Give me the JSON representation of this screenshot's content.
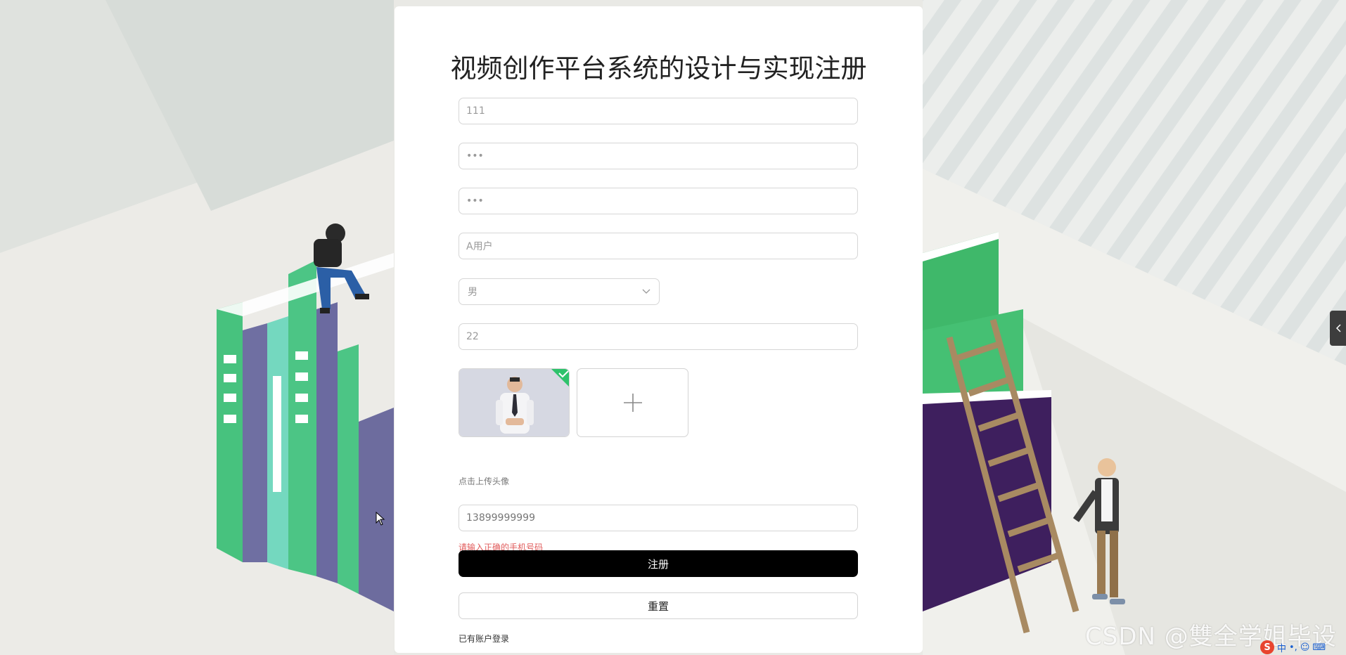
{
  "page": {
    "title": "视频创作平台系统的设计与实现注册"
  },
  "form": {
    "account": {
      "value": "111",
      "placeholder": ""
    },
    "password": {
      "value": "•••",
      "placeholder": ""
    },
    "confirm_password": {
      "value": "•••",
      "placeholder": ""
    },
    "name": {
      "value": "A用户",
      "placeholder": ""
    },
    "gender": {
      "selected": "男"
    },
    "age": {
      "value": "22",
      "placeholder": ""
    },
    "avatar_hint": "点击上传头像",
    "phone": {
      "value": "13899999999",
      "placeholder": ""
    },
    "phone_error": "请输入正确的手机号码",
    "register_label": "注册",
    "reset_label": "重置",
    "login_link": "已有账户登录"
  },
  "overlay": {
    "watermark": "CSDN @雙全学姐毕设",
    "ime_s": "S",
    "ime_lang": "中",
    "ime_punct": "•,"
  },
  "icons": {
    "upload_add": "plus-icon",
    "select_arrow": "chevron-down-icon",
    "side_toggle": "chevron-left-icon"
  },
  "colors": {
    "primary_button": "#000000",
    "error_text": "#e05a5a",
    "book_green": "#3fb86a",
    "book_purple": "#3e1f5e"
  }
}
